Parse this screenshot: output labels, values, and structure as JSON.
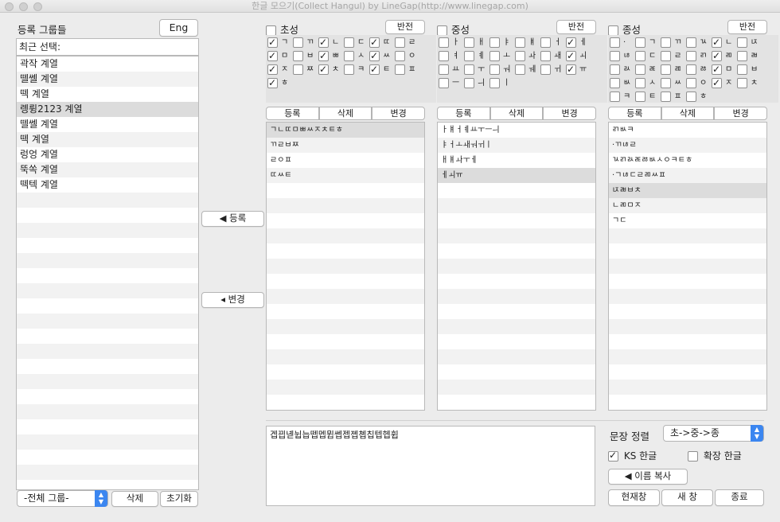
{
  "window": {
    "title": "한글 모으기(Collect Hangul) by LineGap(http://www.linegap.com)"
  },
  "groups": {
    "title": "등록 그룹들",
    "lang_button": "Eng",
    "recent_label": "최근 선택:",
    "items": [
      "곽작 계열",
      "뗄쎌 계열",
      "떽 계열",
      "롕륑2123 계열",
      "뗄쎌 계열",
      "떽 계열",
      "렁엉 계열",
      "뚝쏙 계열",
      "떽텍 계열"
    ],
    "selected_index": 3,
    "group_select": "-전체 그룹-",
    "delete_button": "삭제",
    "reset_button": "초기화"
  },
  "middle": {
    "register_button": "◀ 등록",
    "change_button": "◂ 변경"
  },
  "choseong": {
    "label": "초성",
    "checked": false,
    "invert_button": "반전",
    "jamo": [
      {
        "c": "ㄱ",
        "on": true
      },
      {
        "c": "ㄲ",
        "on": false
      },
      {
        "c": "ㄴ",
        "on": true
      },
      {
        "c": "ㄷ",
        "on": false
      },
      {
        "c": "ㄸ",
        "on": true
      },
      {
        "c": "ㄹ",
        "on": false
      },
      {
        "c": "ㅁ",
        "on": true
      },
      {
        "c": "ㅂ",
        "on": false
      },
      {
        "c": "ㅃ",
        "on": true
      },
      {
        "c": "ㅅ",
        "on": false
      },
      {
        "c": "ㅆ",
        "on": true
      },
      {
        "c": "ㅇ",
        "on": false
      },
      {
        "c": "ㅈ",
        "on": true
      },
      {
        "c": "ㅉ",
        "on": false
      },
      {
        "c": "ㅊ",
        "on": true
      },
      {
        "c": "ㅋ",
        "on": false
      },
      {
        "c": "ㅌ",
        "on": true
      },
      {
        "c": "ㅍ",
        "on": false
      },
      {
        "c": "ㅎ",
        "on": true
      }
    ],
    "buttons": [
      "등록",
      "삭제",
      "변경"
    ],
    "list": [
      "ㄱㄴㄸㅁㅃㅆㅈㅊㅌㅎ",
      "ㄲㄹㅂㅉ",
      "ㄹㅇㅍ",
      "ㄸㅆㅌ"
    ],
    "selected_index": 0
  },
  "jungseong": {
    "label": "중성",
    "checked": false,
    "invert_button": "반전",
    "jamo": [
      {
        "c": "ㅏ",
        "on": false
      },
      {
        "c": "ㅐ",
        "on": false
      },
      {
        "c": "ㅑ",
        "on": false
      },
      {
        "c": "ㅒ",
        "on": false
      },
      {
        "c": "ㅓ",
        "on": false
      },
      {
        "c": "ㅔ",
        "on": true
      },
      {
        "c": "ㅕ",
        "on": false
      },
      {
        "c": "ㅖ",
        "on": false
      },
      {
        "c": "ㅗ",
        "on": false
      },
      {
        "c": "ㅘ",
        "on": false
      },
      {
        "c": "ㅙ",
        "on": false
      },
      {
        "c": "ㅚ",
        "on": true
      },
      {
        "c": "ㅛ",
        "on": false
      },
      {
        "c": "ㅜ",
        "on": false
      },
      {
        "c": "ㅝ",
        "on": false
      },
      {
        "c": "ㅞ",
        "on": false
      },
      {
        "c": "ㅟ",
        "on": false
      },
      {
        "c": "ㅠ",
        "on": true
      },
      {
        "c": "ㅡ",
        "on": false
      },
      {
        "c": "ㅢ",
        "on": false
      },
      {
        "c": "ㅣ",
        "on": false
      }
    ],
    "buttons": [
      "등록",
      "삭제",
      "변경"
    ],
    "list": [
      "ㅏㅒㅓㅖㅛㅜㅡㅢ",
      "ㅑㅓㅗㅙㅝㅟㅣ",
      "ㅐㅒㅘㅜㅔ",
      "ㅔㅚㅠ"
    ],
    "selected_index": 3
  },
  "jongseong": {
    "label": "종성",
    "checked": false,
    "invert_button": "반전",
    "jamo": [
      {
        "c": "·",
        "on": false
      },
      {
        "c": "ㄱ",
        "on": false
      },
      {
        "c": "ㄲ",
        "on": false
      },
      {
        "c": "ㄳ",
        "on": false
      },
      {
        "c": "ㄴ",
        "on": true
      },
      {
        "c": "ㄵ",
        "on": false
      },
      {
        "c": "ㄶ",
        "on": false
      },
      {
        "c": "ㄷ",
        "on": false
      },
      {
        "c": "ㄹ",
        "on": false
      },
      {
        "c": "ㄺ",
        "on": false
      },
      {
        "c": "ㄻ",
        "on": true
      },
      {
        "c": "ㄼ",
        "on": false
      },
      {
        "c": "ㄽ",
        "on": false
      },
      {
        "c": "ㄾ",
        "on": false
      },
      {
        "c": "ㄿ",
        "on": false
      },
      {
        "c": "ㅀ",
        "on": false
      },
      {
        "c": "ㅁ",
        "on": true
      },
      {
        "c": "ㅂ",
        "on": false
      },
      {
        "c": "ㅄ",
        "on": false
      },
      {
        "c": "ㅅ",
        "on": false
      },
      {
        "c": "ㅆ",
        "on": false
      },
      {
        "c": "ㅇ",
        "on": false
      },
      {
        "c": "ㅈ",
        "on": true
      },
      {
        "c": "ㅊ",
        "on": false
      },
      {
        "c": "ㅋ",
        "on": false
      },
      {
        "c": "ㅌ",
        "on": false
      },
      {
        "c": "ㅍ",
        "on": false
      },
      {
        "c": "ㅎ",
        "on": false
      }
    ],
    "buttons": [
      "등록",
      "삭제",
      "변경"
    ],
    "list": [
      "ㄺㅄㅋ",
      "·ㄲㄶㄹ",
      "ㄳㄺㄽㄾㅀㅄㅅㅇㅋㅌㅎ",
      "·ㄱㄶㄷㄹㄻㅆㅍ",
      "ㄵㄼㅂㅊ",
      "ㄴㄻㅁㅈ",
      "ㄱㄷ"
    ],
    "selected_index": 4
  },
  "output": {
    "text": "겝끱녣뉩늡뗍멥뮙쎕젭졥쳽칩텝헵휩"
  },
  "options": {
    "sort_label": "문장 정렬",
    "sort_value": "초->중->종",
    "ks_label": "KS 한글",
    "ks_checked": true,
    "ext_label": "확장 한글",
    "ext_checked": false,
    "copy_button": "◀ 이름 복사",
    "current_button": "현재창",
    "new_button": "새 창",
    "quit_button": "종료"
  }
}
